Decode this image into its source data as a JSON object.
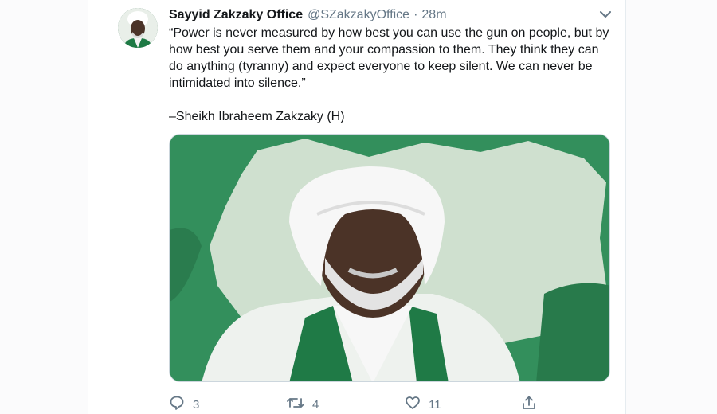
{
  "tweet": {
    "author_name": "Sayyid Zakzaky Office",
    "handle": "@SZakzakyOffice",
    "separator": "·",
    "timestamp": "28m",
    "text": "“Power is never measured by how best you can use the gun on people, but by how best you serve them and your compassion to them. They think they can do anything (tyranny) and expect everyone to keep silent. We can never be intimidated into silence.”",
    "attribution": "–Sheikh Ibraheem Zakzaky (H)"
  },
  "media": {
    "description_icon": "portrait-photo",
    "colors": {
      "background": "#2f8a58",
      "map": "#cfe0cf",
      "accent": "#1f7a46"
    }
  },
  "actions": {
    "reply_count": "3",
    "retweet_count": "4",
    "like_count": "11"
  },
  "icons": {
    "reply": "reply-icon",
    "retweet": "retweet-icon",
    "like": "heart-icon",
    "share": "share-icon",
    "more": "chevron-down-icon"
  }
}
